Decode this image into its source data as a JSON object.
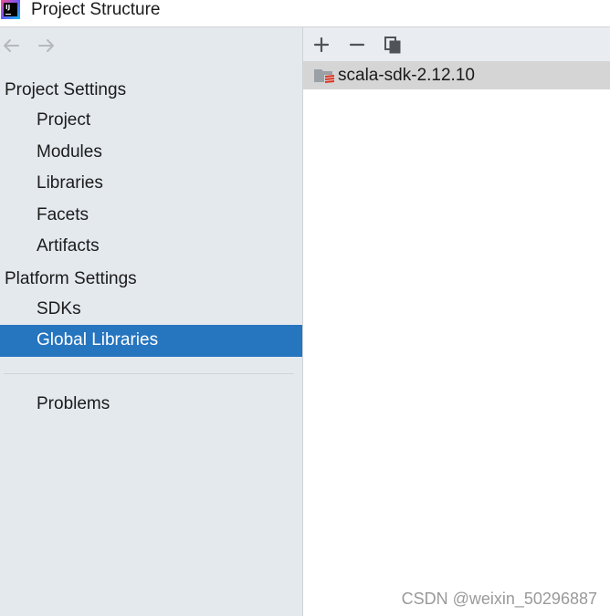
{
  "window": {
    "title": "Project Structure"
  },
  "nav": {
    "back_icon": "arrow-left-icon",
    "forward_icon": "arrow-right-icon"
  },
  "sidebar": {
    "project_settings_header": "Project Settings",
    "project_settings_items": [
      {
        "label": "Project"
      },
      {
        "label": "Modules"
      },
      {
        "label": "Libraries"
      },
      {
        "label": "Facets"
      },
      {
        "label": "Artifacts"
      }
    ],
    "platform_settings_header": "Platform Settings",
    "platform_settings_items": [
      {
        "label": "SDKs"
      },
      {
        "label": "Global Libraries",
        "selected": true
      }
    ],
    "problems_label": "Problems"
  },
  "toolbar": {
    "add_icon": "plus-icon",
    "remove_icon": "minus-icon",
    "copy_icon": "copy-icon"
  },
  "libraries": [
    {
      "name": "scala-sdk-2.12.10"
    }
  ],
  "watermark": "CSDN @weixin_50296887",
  "colors": {
    "selection": "#2675bf",
    "sidebar_bg": "#e4e9ee",
    "list_selection": "#d5d5d5",
    "scala_red": "#de3423"
  }
}
